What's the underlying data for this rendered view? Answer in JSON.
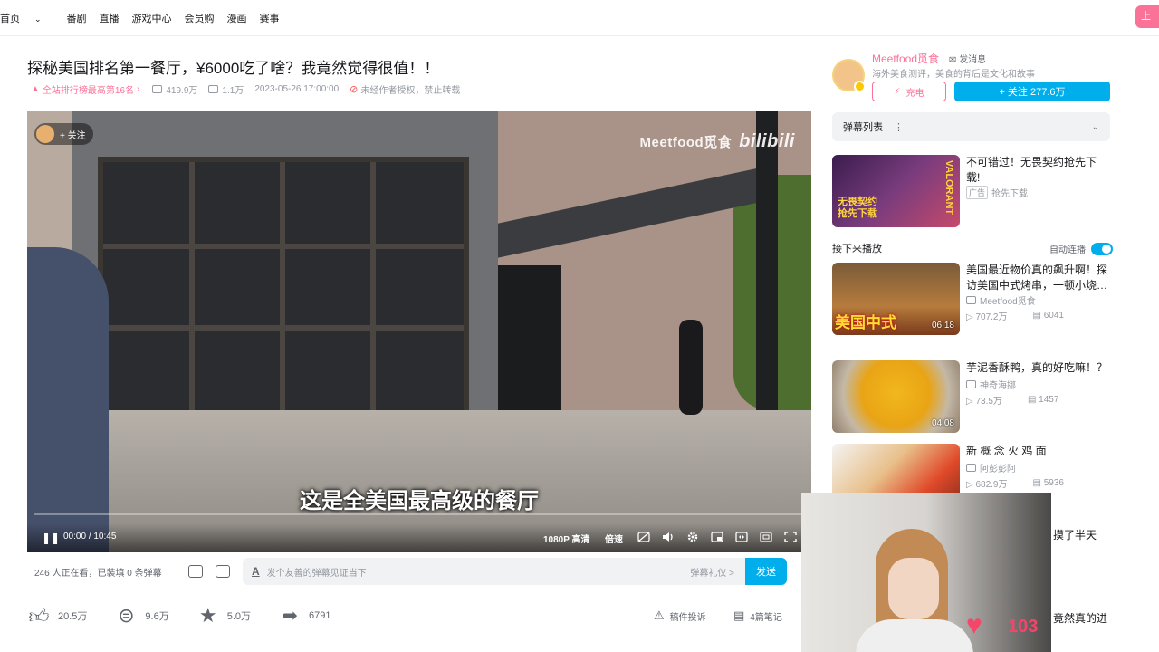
{
  "topnav": {
    "items": [
      "首页",
      "番剧",
      "直播",
      "游戏中心",
      "会员购",
      "漫画",
      "赛事"
    ],
    "home_chevron": "⌄",
    "upload_label": "上"
  },
  "video": {
    "title": "探秘美国排名第一餐厅，¥6000吃了啥？我竟然觉得很值！！",
    "rank": "全站排行榜最高第16名",
    "views": "419.9万",
    "danmaku_count": "1.1万",
    "date": "2023-05-26 17:00:00",
    "copyright": "未经作者授权，禁止转载",
    "overlay_follow": "+ 关注",
    "watermark": "Meetfood觅食",
    "watermark_logo": "bilibili",
    "subtitle": "这是全美国最高级的餐厅",
    "progress": 0.0,
    "time_current": "00:00",
    "time_sep": "/",
    "time_total": "10:45",
    "quality": "1080P 高清",
    "speed": "倍速"
  },
  "danmaku_bar": {
    "count_text": "246 人正在看，已装填 0 条弹幕",
    "placeholder": "发个友善的弹幕见证当下",
    "gift": "弹幕礼仪 >",
    "send": "发送"
  },
  "actions": {
    "like": "20.5万",
    "coin": "9.6万",
    "favorite": "5.0万",
    "share": "6791",
    "report": "稿件投诉",
    "notes": "4篇笔记"
  },
  "uploader": {
    "name": "Meetfood觅食",
    "message": "发消息",
    "desc": "海外美食测评，美食的背后是文化和故事",
    "charge": "充电",
    "follow": "+ 关注 277.6万"
  },
  "danmaku_list": {
    "label": "弹幕列表",
    "dots": "⋮",
    "chevron": "⌄"
  },
  "ad": {
    "title": "不可错过！无畏契约抢先下载!",
    "tag": "广告",
    "sub": "抢先下载",
    "thumb_text": "无畏契约\n抢先下载",
    "thumb_brand": "VALORANT"
  },
  "next": {
    "label": "接下来播放",
    "autoplay": "自动连播"
  },
  "recommendations": [
    {
      "title": "美国最近物价真的飙升啊！探访美国中式烤串，一顿小烧…",
      "up": "Meetfood觅食",
      "views": "707.2万",
      "danmaku": "6041",
      "duration": "06:18",
      "thumb_text": "美国中式"
    },
    {
      "title": "芋泥香酥鸭，真的好吃嘛！？",
      "up": "神奇海挪",
      "views": "73.5万",
      "danmaku": "1457",
      "duration": "04:08"
    },
    {
      "title": "新 概 念 火 鸡 面",
      "up": "阿彭彭阿",
      "views": "682.9万",
      "danmaku": "5936"
    }
  ],
  "cam": {
    "hearts": "103",
    "tail1": "摸了半天",
    "tail2": "竟然真的进"
  },
  "colors": {
    "accent": "#00aeec",
    "pink": "#fb7299"
  }
}
